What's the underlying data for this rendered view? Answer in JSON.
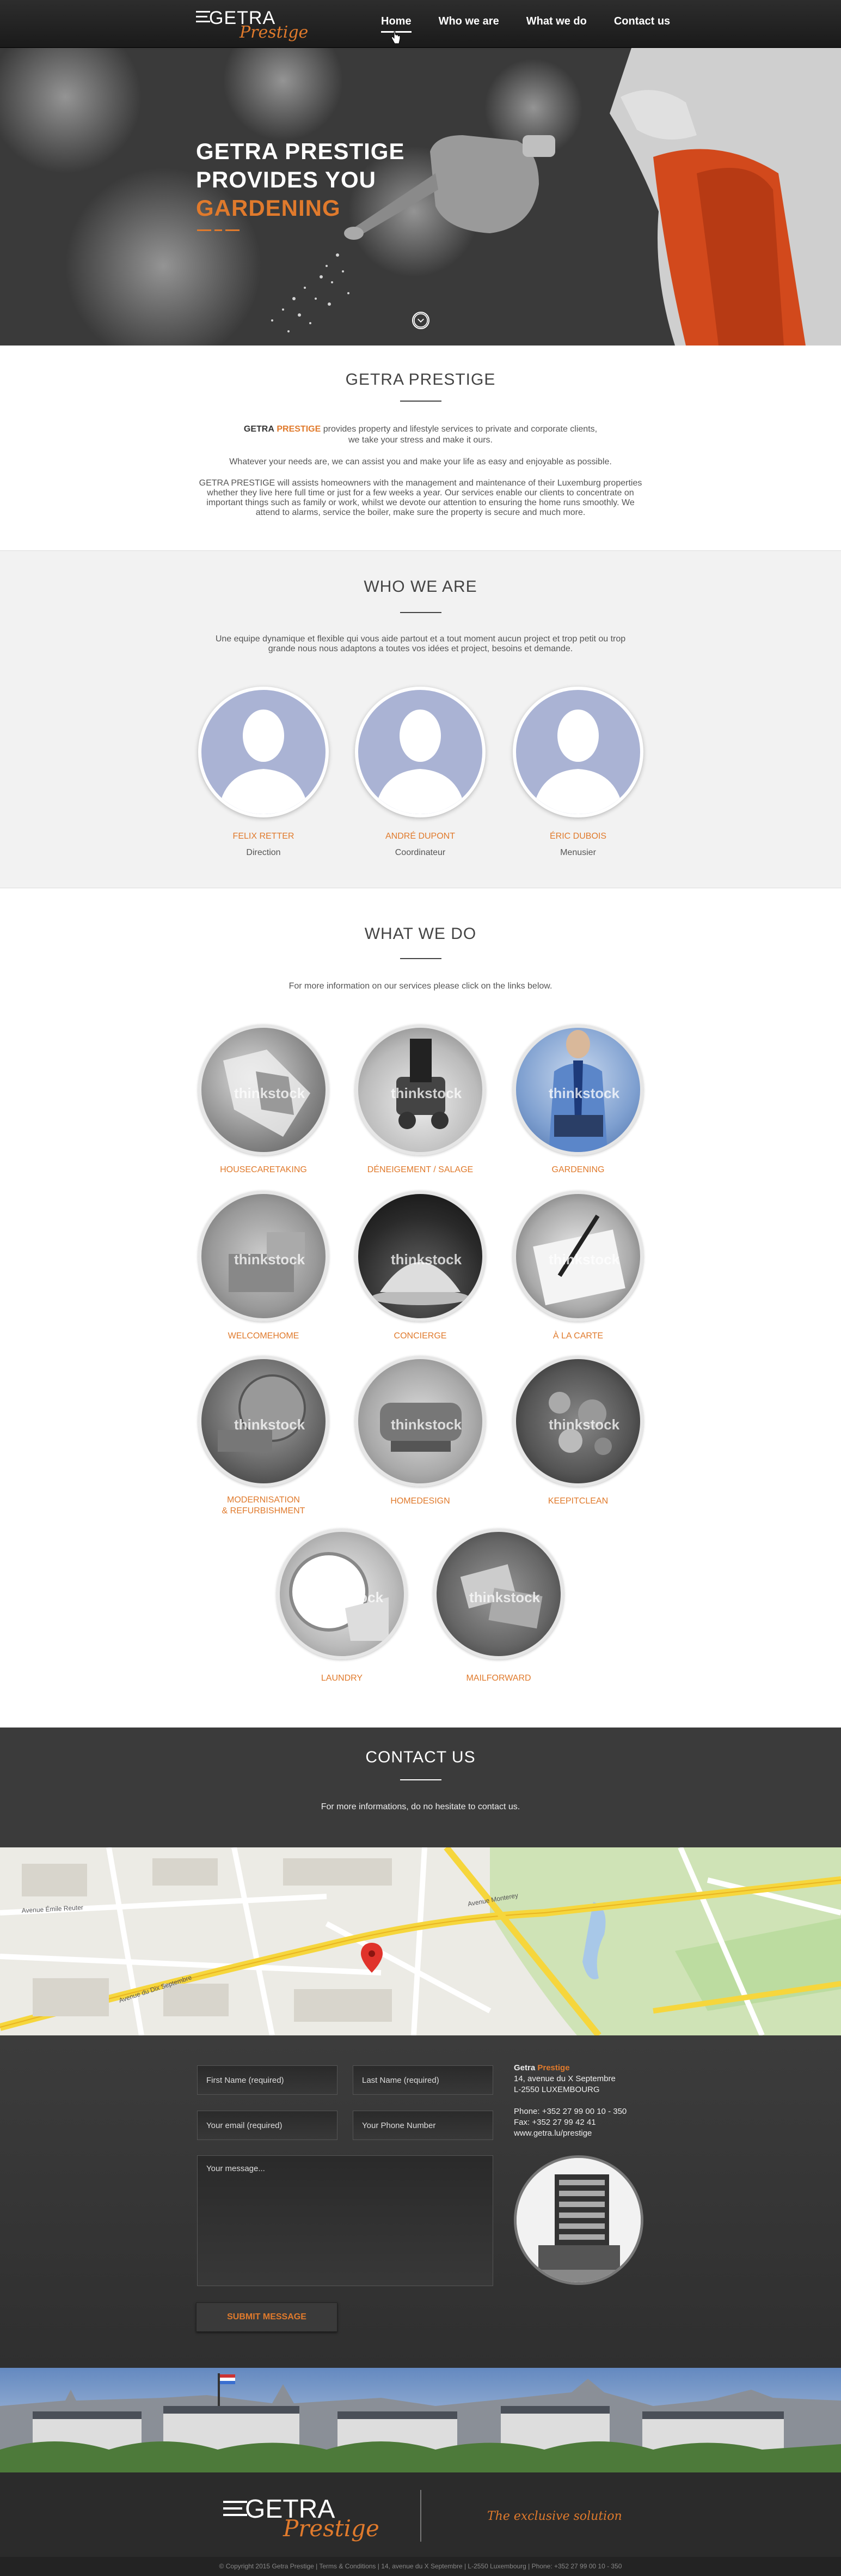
{
  "brand": {
    "name": "GETRA",
    "script": "Prestige",
    "tagline": "The exclusive solution"
  },
  "nav": {
    "items": [
      "Home",
      "Who we are",
      "What we do",
      "Contact us"
    ],
    "active": "Home"
  },
  "hero": {
    "line1": "GETRA PRESTIGE",
    "line2": "PROVIDES YOU",
    "line3": "GARDENING"
  },
  "intro": {
    "title": "GETRA PRESTIGE",
    "lead_brand_a": "GETRA",
    "lead_brand_b": "PRESTIGE",
    "lead_rest": "provides property and lifestyle services to private and corporate clients,",
    "lead_line2": "we take your stress and make it ours.",
    "p2": "Whatever your needs are, we can assist you and make your life as easy and enjoyable as possible.",
    "p3_l1": "GETRA PRESTIGE will assists homeowners with the management and maintenance of their Luxemburg properties",
    "p3_l2": "whether they live here full time or just for a few weeks a year. Our services enable our clients to concentrate on",
    "p3_l3": "important things such as family or work, whilst we devote our attention to ensuring the home runs smoothly. We",
    "p3_l4": "attend to alarms, service the boiler, make sure the property is secure and much more."
  },
  "who": {
    "title": "WHO WE ARE",
    "text_l1": "Une equipe dynamique et flexible qui vous aide partout et a tout moment aucun project et trop petit ou trop",
    "text_l2": "grande nous nous adaptons a toutes vos idées et project, besoins et demande.",
    "team": [
      {
        "name": "FELIX RETTER",
        "role": "Direction"
      },
      {
        "name": "ANDRÉ DUPONT",
        "role": "Coordinateur"
      },
      {
        "name": "ÉRIC DUBOIS",
        "role": "Menusier"
      }
    ]
  },
  "what": {
    "title": "WHAT WE DO",
    "text": "For more information on our services please click on the links below.",
    "watermark": "thinkstock",
    "services": [
      {
        "label": "HOUSECARETAKING"
      },
      {
        "label": "DÉNEIGEMENT / SALAGE"
      },
      {
        "label": "GARDENING"
      },
      {
        "label": "WELCOMEHOME"
      },
      {
        "label": "CONCIERGE"
      },
      {
        "label": "À LA CARTE"
      },
      {
        "label": "MODERNISATION",
        "label2": "& REFURBISHMENT"
      },
      {
        "label": "HOMEDESIGN"
      },
      {
        "label": "KEEPITCLEAN"
      },
      {
        "label": "LAUNDRY"
      },
      {
        "label": "MAILFORWARD"
      }
    ]
  },
  "contact": {
    "title": "CONTACT US",
    "text": "For more informations, do no hesitate to contact us.",
    "form": {
      "first_name": "First Name (required)",
      "last_name": "Last Name (required)",
      "email": "Your email (required)",
      "phone": "Your Phone Number",
      "message": "Your message...",
      "submit": "SUBMIT MESSAGE"
    },
    "info": {
      "brand_a": "Getra",
      "brand_b": "Prestige",
      "address1": "14, avenue du X Septembre",
      "address2": "L-2550 LUXEMBOURG",
      "phone": "Phone: +352 27 99 00 10 - 350",
      "fax": "Fax: +352 27 99 42 41",
      "web": "www.getra.lu/prestige"
    },
    "map_labels": {
      "street1": "Avenue Monterey",
      "street2": "Avenue du Dix Septembre",
      "street3": "Avenue Émile Reuter"
    }
  },
  "copyright": "© Copyright 2015 Getra Prestige  |  Terms & Conditions  |  14, avenue du X Septembre  |  L-2550 Luxembourg  |  Phone: +352 27 99 00 10 - 350",
  "colors": {
    "accent": "#e07a2c",
    "dark": "#2b2b2b",
    "avatar": "#aab3d4"
  }
}
